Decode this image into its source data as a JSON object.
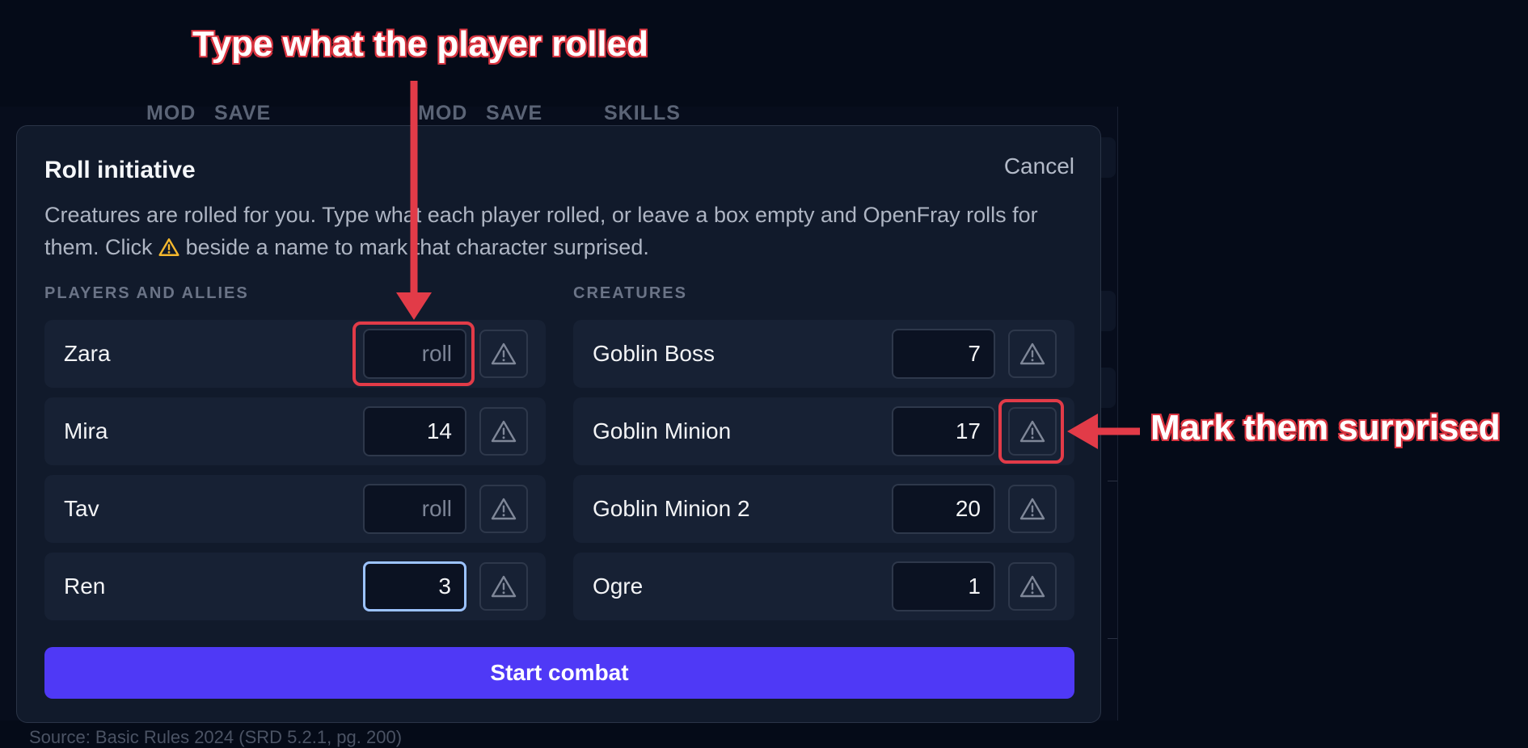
{
  "background": {
    "headers": [
      "MOD",
      "SAVE",
      "MOD",
      "SAVE",
      "SKILLS"
    ],
    "footer": "Source: Basic Rules 2024 (SRD 5.2.1, pg. 200)"
  },
  "modal": {
    "title": "Roll initiative",
    "cancel_label": "Cancel",
    "description_part1": "Creatures are rolled for you. Type what each player rolled, or leave a box empty and OpenFray rolls for them. Click",
    "description_part2": "beside a name to mark that character surprised.",
    "players_heading": "PLAYERS AND ALLIES",
    "creatures_heading": "CREATURES",
    "roll_placeholder": "roll",
    "players": [
      {
        "name": "Zara",
        "value": ""
      },
      {
        "name": "Mira",
        "value": "14"
      },
      {
        "name": "Tav",
        "value": ""
      },
      {
        "name": "Ren",
        "value": "3"
      }
    ],
    "creatures": [
      {
        "name": "Goblin Boss",
        "value": "7"
      },
      {
        "name": "Goblin Minion",
        "value": "17"
      },
      {
        "name": "Goblin Minion 2",
        "value": "20"
      },
      {
        "name": "Ogre",
        "value": "1"
      }
    ],
    "start_label": "Start combat"
  },
  "annotations": {
    "top_label": "Type what the player rolled",
    "right_label": "Mark them surprised",
    "color": "#e23b48"
  },
  "colors": {
    "accent": "#4f39f6",
    "warning_icon": "#f5b82e",
    "focus_ring": "#9cc3ff"
  },
  "icons": {
    "surprise": "warning-triangle-icon"
  }
}
